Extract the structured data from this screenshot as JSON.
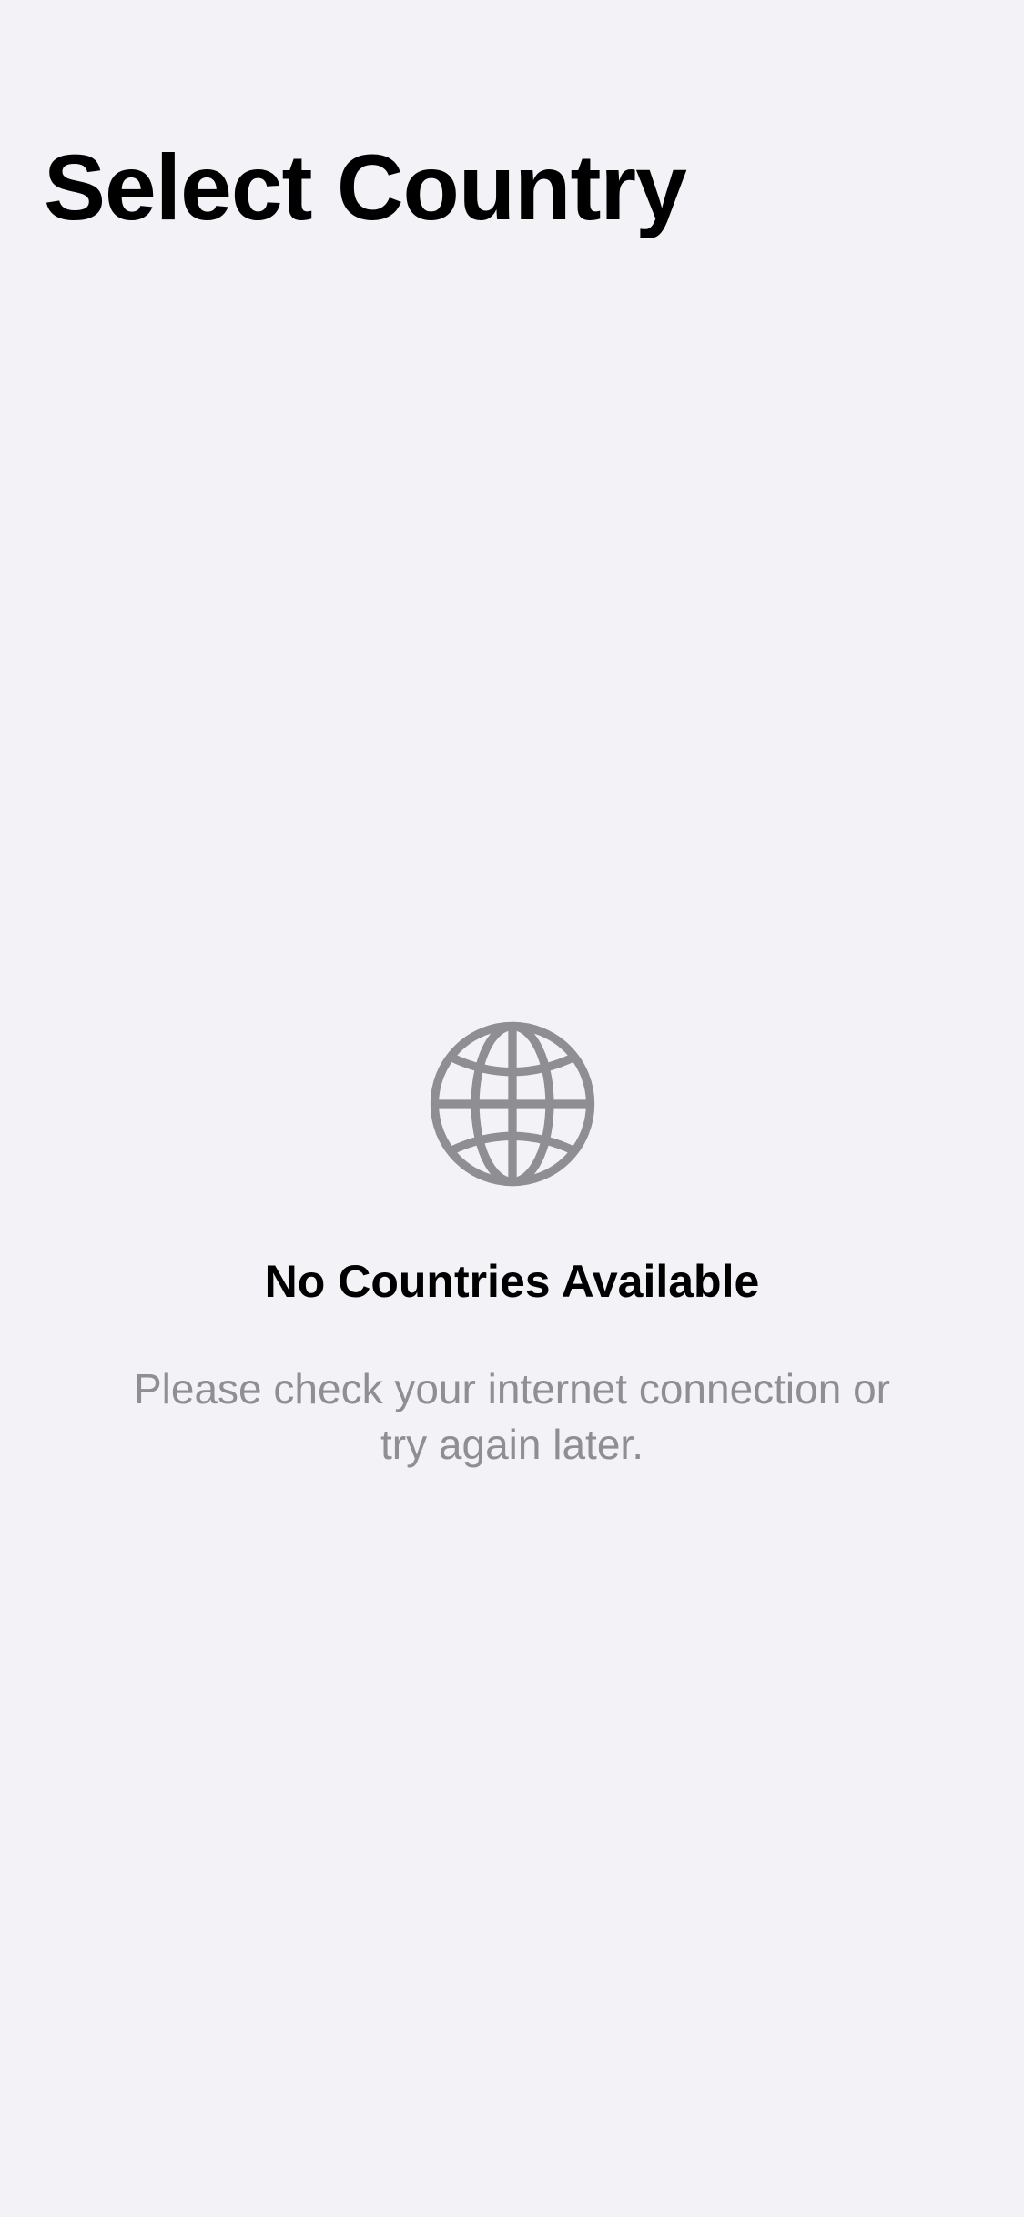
{
  "header": {
    "title": "Select Country"
  },
  "empty_state": {
    "icon": "globe-icon",
    "title": "No Countries Available",
    "message": "Please check your internet connection or try again later."
  },
  "colors": {
    "background": "#F2F2F7",
    "title_text": "#000000",
    "secondary_text": "#8E8E93",
    "icon": "#8E8E93"
  }
}
